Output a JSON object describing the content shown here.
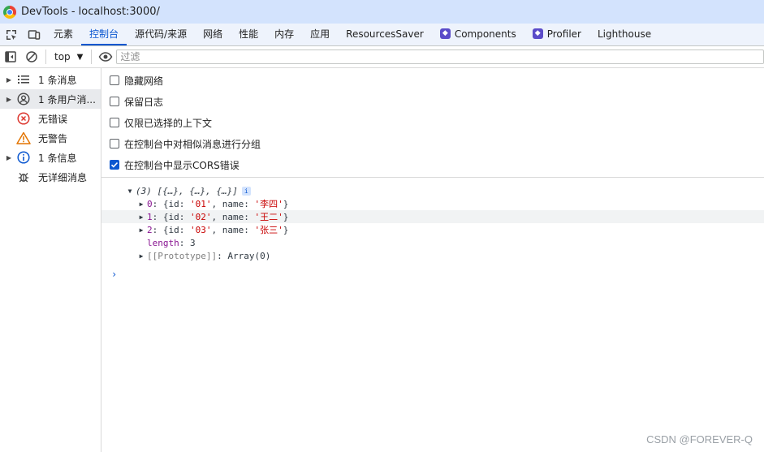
{
  "window": {
    "title": "DevTools - localhost:3000/"
  },
  "tabs": [
    {
      "label": "元素",
      "active": false
    },
    {
      "label": "控制台",
      "active": true
    },
    {
      "label": "源代码/来源",
      "active": false
    },
    {
      "label": "网络",
      "active": false
    },
    {
      "label": "性能",
      "active": false
    },
    {
      "label": "内存",
      "active": false
    },
    {
      "label": "应用",
      "active": false
    },
    {
      "label": "ResourcesSaver",
      "active": false
    },
    {
      "label": "Components",
      "active": false,
      "icon": "vue-devtools-icon"
    },
    {
      "label": "Profiler",
      "active": false,
      "icon": "vue-devtools-icon"
    },
    {
      "label": "Lighthouse",
      "active": false
    }
  ],
  "toolbar": {
    "context": "top",
    "filter_placeholder": "过滤"
  },
  "sidebar": {
    "items": [
      {
        "label": "1 条消息",
        "icon": "list-icon",
        "expandable": true
      },
      {
        "label": "1 条用户消...",
        "icon": "user-icon",
        "expandable": true,
        "selected": true
      },
      {
        "label": "无错误",
        "icon": "error-icon",
        "expandable": false
      },
      {
        "label": "无警告",
        "icon": "warning-icon",
        "expandable": false
      },
      {
        "label": "1 条信息",
        "icon": "info-icon",
        "expandable": true
      },
      {
        "label": "无详细消息",
        "icon": "bug-icon",
        "expandable": false
      }
    ]
  },
  "settings": [
    {
      "label": "隐藏网络",
      "checked": false
    },
    {
      "label": "保留日志",
      "checked": false
    },
    {
      "label": "仅限已选择的上下文",
      "checked": false
    },
    {
      "label": "在控制台中对相似消息进行分组",
      "checked": false
    },
    {
      "label": "在控制台中显示CORS错误",
      "checked": true
    }
  ],
  "console": {
    "summary": "(3) [{…}, {…}, {…}]",
    "items": [
      {
        "index": "0",
        "id": "'01'",
        "name": "'李四'"
      },
      {
        "index": "1",
        "id": "'02'",
        "name": "'王二'"
      },
      {
        "index": "2",
        "id": "'03'",
        "name": "'张三'"
      }
    ],
    "length_key": "length",
    "length_value": "3",
    "proto_key": "[[Prototype]]",
    "proto_value": "Array(0)",
    "prompt": "›"
  },
  "watermark": "CSDN @FOREVER-Q",
  "colors": {
    "accent": "#0b57d0",
    "titlebar": "#d3e3fd",
    "tabbar": "#eef3fc"
  }
}
